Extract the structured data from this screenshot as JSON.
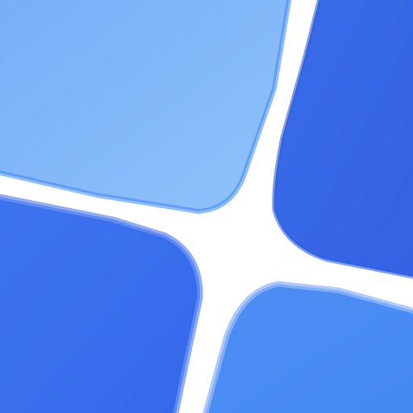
{
  "app_icon": {
    "name": "four-tile-grid-icon",
    "background": "#ffffff",
    "tiles": [
      {
        "id": "top-left",
        "fill_from": "#76aef7",
        "fill_to": "#90c2fb",
        "rim": "#3f86ef"
      },
      {
        "id": "top-right",
        "fill_from": "#3a6cea",
        "fill_to": "#3362e2",
        "rim": "#2f5fe0"
      },
      {
        "id": "bottom-left",
        "fill_from": "#3f74f0",
        "fill_to": "#3468ea",
        "rim": "#6b93f5"
      },
      {
        "id": "bottom-right",
        "fill_from": "#4d8ef5",
        "fill_to": "#4688f3",
        "rim": "#8fb8ff"
      }
    ]
  }
}
